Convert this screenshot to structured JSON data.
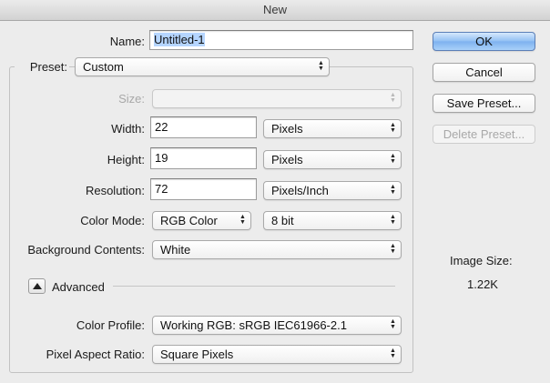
{
  "window": {
    "title": "New"
  },
  "form": {
    "name_label": "Name:",
    "name_value": "Untitled-1",
    "preset_label": "Preset:",
    "preset_value": "Custom",
    "size_label": "Size:",
    "size_value": "",
    "width_label": "Width:",
    "width_value": "22",
    "width_unit": "Pixels",
    "height_label": "Height:",
    "height_value": "19",
    "height_unit": "Pixels",
    "resolution_label": "Resolution:",
    "resolution_value": "72",
    "resolution_unit": "Pixels/Inch",
    "color_mode_label": "Color Mode:",
    "color_mode_value": "RGB Color",
    "bit_depth_value": "8 bit",
    "background_label": "Background Contents:",
    "background_value": "White"
  },
  "advanced": {
    "label": "Advanced",
    "color_profile_label": "Color Profile:",
    "color_profile_value": "Working RGB:  sRGB IEC61966-2.1",
    "pixel_aspect_label": "Pixel Aspect Ratio:",
    "pixel_aspect_value": "Square Pixels"
  },
  "buttons": {
    "ok": "OK",
    "cancel": "Cancel",
    "save_preset": "Save Preset...",
    "delete_preset": "Delete Preset..."
  },
  "image_size": {
    "label": "Image Size:",
    "value": "1.22K"
  },
  "icons": {
    "popup_arrows": "updown-chevron-icon",
    "disclosure": "disclosure-triangle-up-icon"
  },
  "colors": {
    "default_button": "#7db1ef",
    "selection": "#b5d5ff"
  }
}
